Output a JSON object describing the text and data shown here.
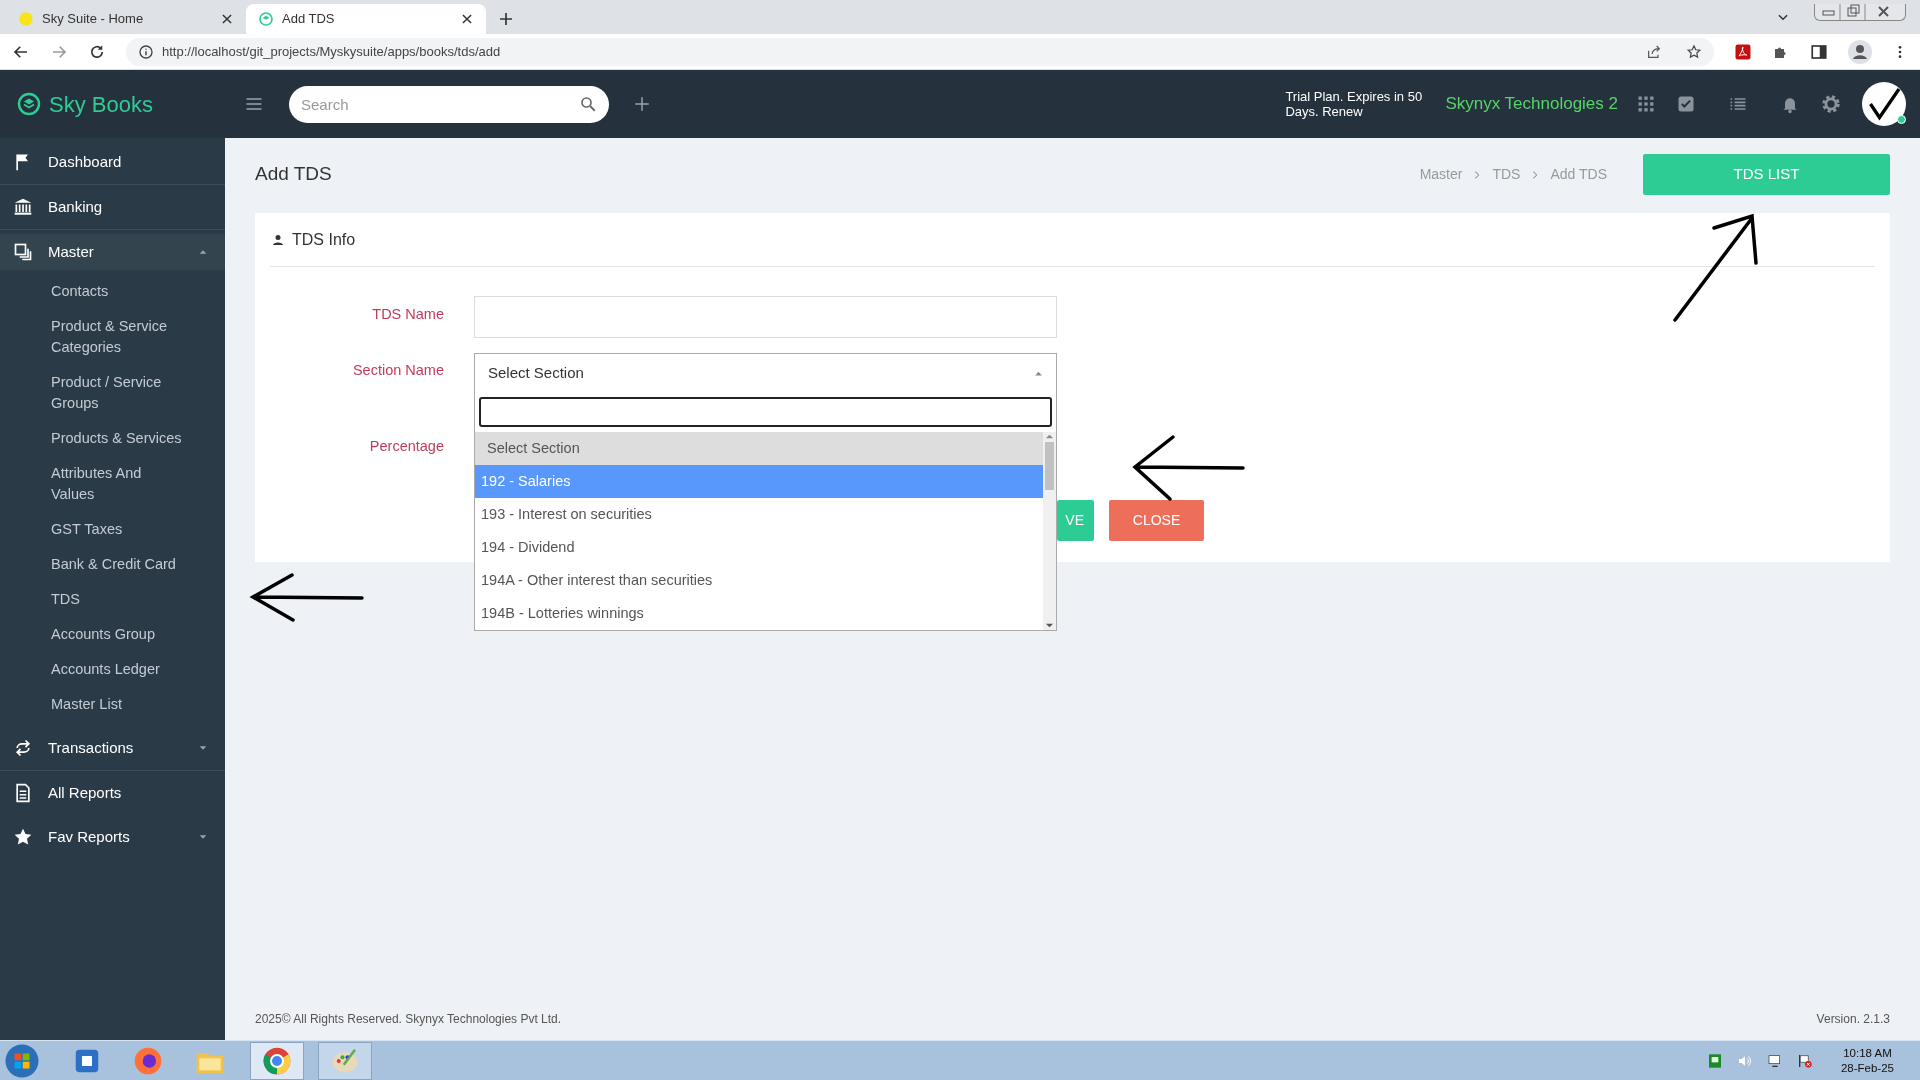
{
  "browser": {
    "tabs": [
      {
        "title": "Sky Suite - Home",
        "selected": false
      },
      {
        "title": "Add TDS",
        "selected": true
      }
    ],
    "url": "http://localhost/git_projects/Myskysuite/apps/books/tds/add"
  },
  "header": {
    "brand": "Sky Books",
    "search": {
      "placeholder": "Search"
    },
    "trial_notice": "Trial Plan. Expires in 50 Days. Renew",
    "company": "Skynyx Technologies 2"
  },
  "sidebar": {
    "items": [
      {
        "label": "Dashboard",
        "kind": "link"
      },
      {
        "label": "Banking",
        "kind": "link"
      },
      {
        "label": "Master",
        "kind": "group",
        "expanded": true,
        "children": [
          {
            "label": "Contacts",
            "selected": false
          },
          {
            "label": "Product & Service Categories",
            "selected": false
          },
          {
            "label": "Product / Service Groups",
            "selected": false
          },
          {
            "label": "Products & Services",
            "selected": false
          },
          {
            "label": "Attributes And Values",
            "selected": false
          },
          {
            "label": "GST Taxes",
            "selected": false
          },
          {
            "label": "Bank & Credit Card",
            "selected": false
          },
          {
            "label": "TDS",
            "selected": false
          },
          {
            "label": "Accounts Group",
            "selected": false
          },
          {
            "label": "Accounts Ledger",
            "selected": false
          },
          {
            "label": "Master List",
            "selected": false
          }
        ]
      },
      {
        "label": "Transactions",
        "kind": "group",
        "expanded": false
      },
      {
        "label": "All Reports",
        "kind": "link"
      },
      {
        "label": "Fav Reports",
        "kind": "group",
        "expanded": false
      }
    ]
  },
  "page": {
    "title": "Add TDS",
    "breadcrumb": [
      "Master",
      "TDS",
      "Add TDS"
    ],
    "list_button": "TDS LIST"
  },
  "card": {
    "title": "TDS Info",
    "fields": [
      {
        "label": "TDS Name",
        "kind": "text"
      },
      {
        "label": "Section Name",
        "kind": "select",
        "value": "Select Section",
        "expanded": true
      },
      {
        "label": "Percentage",
        "kind": "number"
      }
    ],
    "dropdown": {
      "options": [
        {
          "label": "Select Section",
          "current": true,
          "selected": false
        },
        {
          "label": "192 - Salaries",
          "current": false,
          "selected": true
        },
        {
          "label": "193 - Interest on securities",
          "current": false,
          "selected": false
        },
        {
          "label": "194 - Dividend",
          "current": false,
          "selected": false
        },
        {
          "label": "194A - Other interest than securities",
          "current": false,
          "selected": false
        },
        {
          "label": "194B - Lotteries winnings",
          "current": false,
          "selected": false
        }
      ]
    },
    "buttons": [
      {
        "label": "VE",
        "kind": "save"
      },
      {
        "label": "CLOSE",
        "kind": "close"
      }
    ]
  },
  "footer": {
    "copyright": "2025© All Rights Reserved. Skynyx Technologies Pvt Ltd.",
    "version": "Version. 2.1.3"
  },
  "taskbar": {
    "time": "10:18 AM",
    "date": "28-Feb-25"
  }
}
